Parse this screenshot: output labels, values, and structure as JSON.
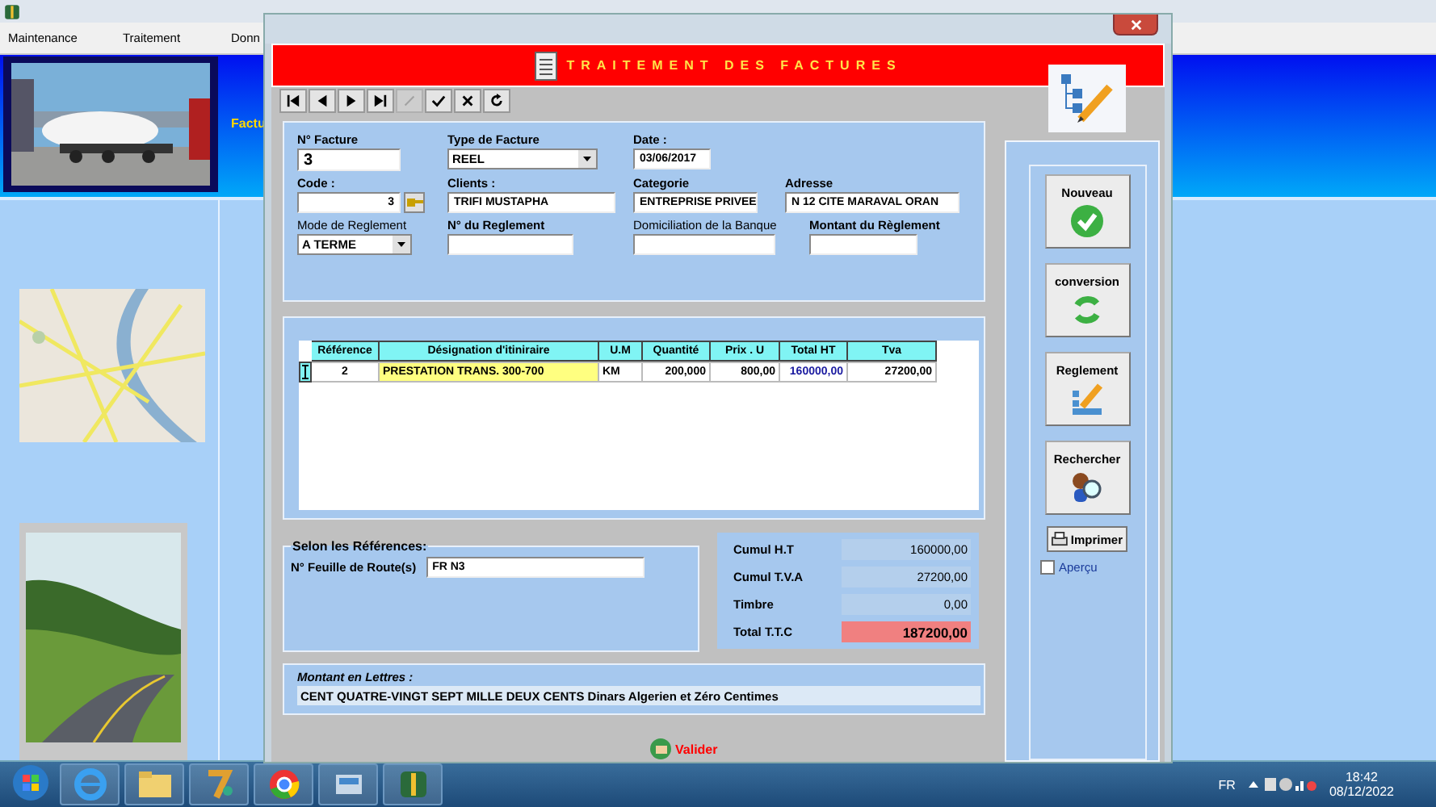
{
  "app": {
    "menu": [
      "Maintenance",
      "Traitement",
      "Donn"
    ],
    "side_label": "Factu"
  },
  "dialog": {
    "title": "TRAITEMENT DES FACTURES",
    "toolbar": [
      {
        "kind": "first",
        "disabled": false
      },
      {
        "kind": "prev",
        "disabled": false
      },
      {
        "kind": "next",
        "disabled": false
      },
      {
        "kind": "last",
        "disabled": false
      },
      {
        "kind": "edit",
        "disabled": true
      },
      {
        "kind": "save",
        "disabled": false
      },
      {
        "kind": "cancel",
        "disabled": false
      },
      {
        "kind": "refresh",
        "disabled": false
      }
    ],
    "form": [
      [
        {
          "label": "N° Facture",
          "value": "3",
          "kind": "big"
        },
        {
          "label": "Type de Facture",
          "value": "REEL",
          "kind": "combo"
        },
        {
          "label": "Date :",
          "value": "03/06/2017",
          "kind": "text"
        }
      ],
      [
        {
          "label": "Code :",
          "value": "3",
          "kind": "lookup"
        },
        {
          "label": "Clients :",
          "value": "TRIFI  MUSTAPHA",
          "kind": "text"
        },
        {
          "label": "Categorie",
          "value": "ENTREPRISE PRIVEE",
          "kind": "text"
        },
        {
          "label": "Adresse",
          "value": "N 12 CITE MARAVAL ORAN",
          "kind": "text"
        }
      ],
      [
        {
          "label": "Mode de Reglement",
          "value": "A TERME",
          "kind": "combo"
        },
        {
          "label": "N° du Reglement",
          "kind": "text"
        },
        {
          "label": "Domiciliation de la Banque",
          "kind": "text"
        },
        {
          "label": "Montant du Règlement",
          "kind": "text"
        }
      ]
    ],
    "grid": {
      "columns": [
        "Référence",
        "Désignation d'itiniraire",
        "U.M",
        "Quantité",
        "Prix . U",
        "Total HT",
        "Tva"
      ],
      "rows": [
        {
          "cells": [
            {
              "text": "2",
              "selected": false
            },
            {
              "text": "PRESTATION TRANS. 300-700",
              "selected": true
            },
            {
              "text": "KM",
              "selected": false
            },
            {
              "text": "200,000",
              "selected": false
            },
            {
              "text": "800,00",
              "selected": false
            },
            {
              "text": "160000,00",
              "selected": false
            },
            {
              "text": "27200,00",
              "selected": false
            }
          ]
        }
      ]
    },
    "references": {
      "legend": "Selon les Références:",
      "label": "N° Feuille de Route(s)",
      "value": "FR N3"
    },
    "totals": [
      {
        "label": "Cumul  H.T",
        "value": "160000,00",
        "highlight": false
      },
      {
        "label": "Cumul T.V.A",
        "value": "27200,00",
        "highlight": false
      },
      {
        "label": "Timbre",
        "value": "0,00",
        "highlight": false
      },
      {
        "label": "Total T.T.C",
        "value": "187200,00",
        "highlight": true
      }
    ],
    "amount_words": {
      "label": "Montant en Lettres :",
      "text": "CENT QUATRE-VINGT SEPT MILLE DEUX CENTS Dinars Algerien et Zéro Centimes"
    },
    "actions": [
      {
        "label": "Nouveau",
        "kind": "new"
      },
      {
        "label": "conversion",
        "kind": "convert"
      },
      {
        "label": "Reglement",
        "kind": "payment"
      },
      {
        "label": "Rechercher",
        "kind": "search"
      }
    ],
    "print": {
      "label": "Imprimer"
    },
    "preview": {
      "label": "Aperçu",
      "checked": false
    },
    "validate": {
      "label": "Valider"
    }
  },
  "taskbar": {
    "language": "FR",
    "time": "18:42",
    "date": "08/12/2022"
  }
}
